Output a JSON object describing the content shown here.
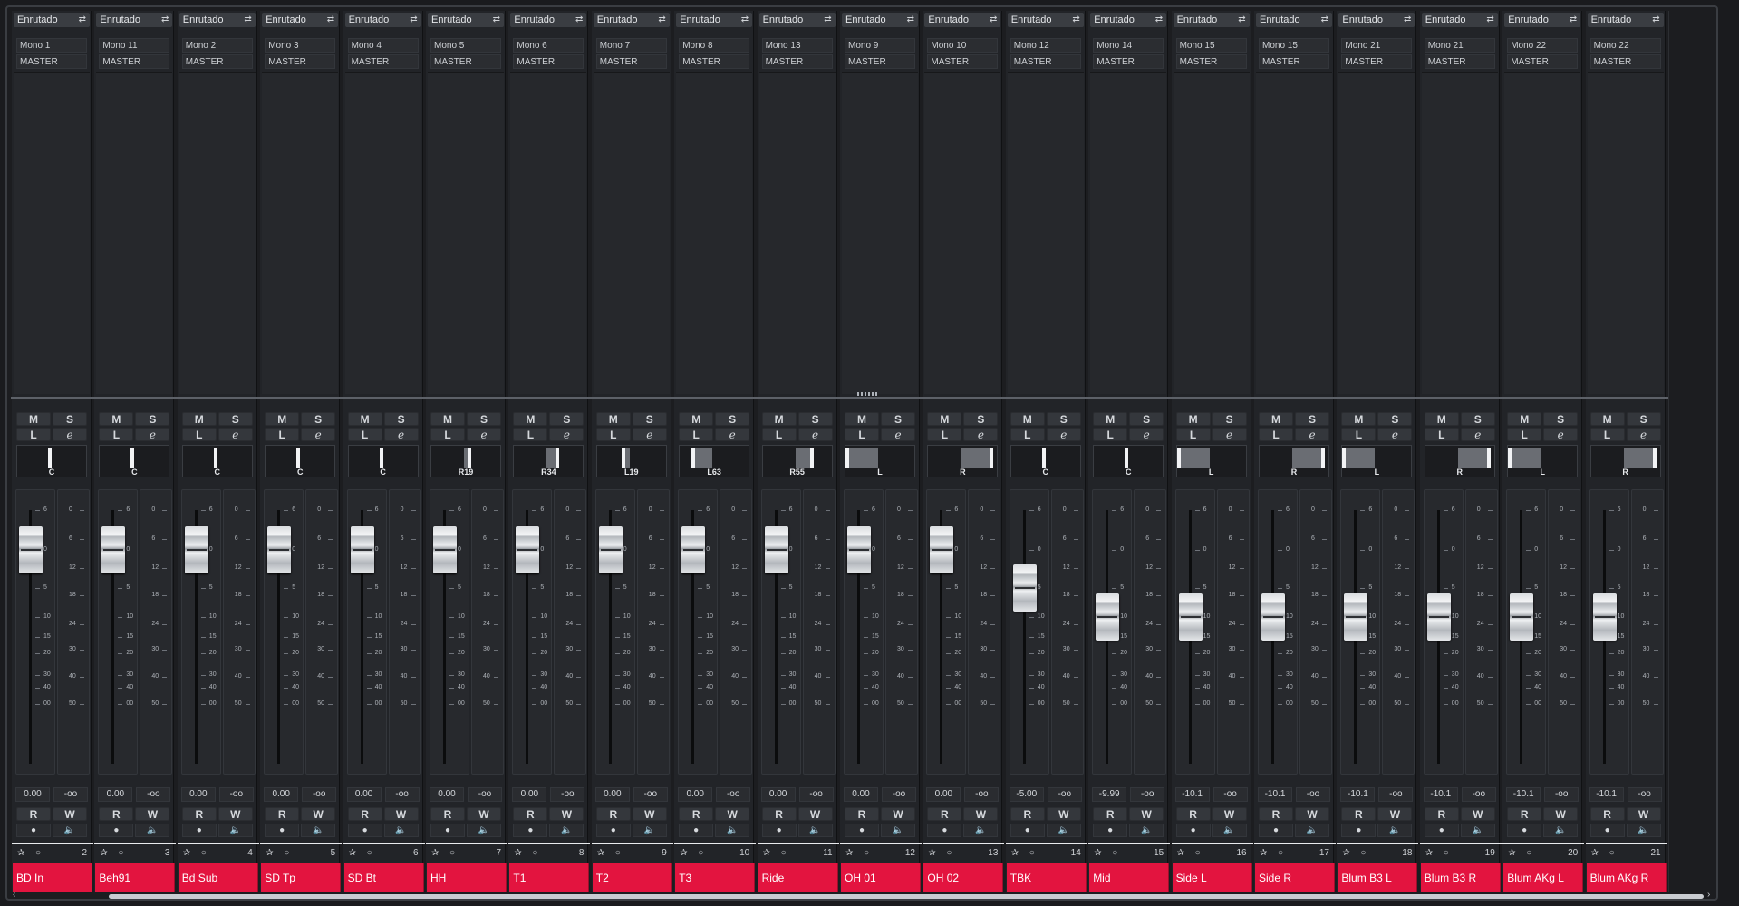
{
  "channels": [
    {
      "route_label": "Enrutado",
      "input": "Mono 1",
      "output": "MASTER",
      "pan_label": "C",
      "volume": "0.00",
      "peak": "-oo",
      "number": "2",
      "name": "BD In",
      "fader_db": 0
    },
    {
      "route_label": "Enrutado",
      "input": "Mono 11",
      "output": "MASTER",
      "pan_label": "C",
      "volume": "0.00",
      "peak": "-oo",
      "number": "3",
      "name": "Beh91",
      "fader_db": 0
    },
    {
      "route_label": "Enrutado",
      "input": "Mono 2",
      "output": "MASTER",
      "pan_label": "C",
      "volume": "0.00",
      "peak": "-oo",
      "number": "4",
      "name": "Bd Sub",
      "fader_db": 0
    },
    {
      "route_label": "Enrutado",
      "input": "Mono 3",
      "output": "MASTER",
      "pan_label": "C",
      "volume": "0.00",
      "peak": "-oo",
      "number": "5",
      "name": "SD Tp",
      "fader_db": 0
    },
    {
      "route_label": "Enrutado",
      "input": "Mono 4",
      "output": "MASTER",
      "pan_label": "C",
      "volume": "0.00",
      "peak": "-oo",
      "number": "6",
      "name": "SD Bt",
      "fader_db": 0
    },
    {
      "route_label": "Enrutado",
      "input": "Mono 5",
      "output": "MASTER",
      "pan_label": "R19",
      "volume": "0.00",
      "peak": "-oo",
      "number": "7",
      "name": "HH",
      "fader_db": 0
    },
    {
      "route_label": "Enrutado",
      "input": "Mono 6",
      "output": "MASTER",
      "pan_label": "R34",
      "volume": "0.00",
      "peak": "-oo",
      "number": "8",
      "name": "T1",
      "fader_db": 0
    },
    {
      "route_label": "Enrutado",
      "input": "Mono 7",
      "output": "MASTER",
      "pan_label": "L19",
      "volume": "0.00",
      "peak": "-oo",
      "number": "9",
      "name": "T2",
      "fader_db": 0
    },
    {
      "route_label": "Enrutado",
      "input": "Mono 8",
      "output": "MASTER",
      "pan_label": "L63",
      "volume": "0.00",
      "peak": "-oo",
      "number": "10",
      "name": "T3",
      "fader_db": 0
    },
    {
      "route_label": "Enrutado",
      "input": "Mono 13",
      "output": "MASTER",
      "pan_label": "R55",
      "volume": "0.00",
      "peak": "-oo",
      "number": "11",
      "name": "Ride",
      "fader_db": 0
    },
    {
      "route_label": "Enrutado",
      "input": "Mono 9",
      "output": "MASTER",
      "pan_label": "L",
      "volume": "0.00",
      "peak": "-oo",
      "number": "12",
      "name": "OH 01",
      "fader_db": 0
    },
    {
      "route_label": "Enrutado",
      "input": "Mono 10",
      "output": "MASTER",
      "pan_label": "R",
      "volume": "0.00",
      "peak": "-oo",
      "number": "13",
      "name": "OH 02",
      "fader_db": 0
    },
    {
      "route_label": "Enrutado",
      "input": "Mono 12",
      "output": "MASTER",
      "pan_label": "C",
      "volume": "-5.00",
      "peak": "-oo",
      "number": "14",
      "name": "TBK",
      "fader_db": -5
    },
    {
      "route_label": "Enrutado",
      "input": "Mono 14",
      "output": "MASTER",
      "pan_label": "C",
      "volume": "-9.99",
      "peak": "-oo",
      "number": "15",
      "name": "Mid",
      "fader_db": -10
    },
    {
      "route_label": "Enrutado",
      "input": "Mono 15",
      "output": "MASTER",
      "pan_label": "L",
      "volume": "-10.1",
      "peak": "-oo",
      "number": "16",
      "name": "Side L",
      "fader_db": -10
    },
    {
      "route_label": "Enrutado",
      "input": "Mono 15",
      "output": "MASTER",
      "pan_label": "R",
      "volume": "-10.1",
      "peak": "-oo",
      "number": "17",
      "name": "Side R",
      "fader_db": -10
    },
    {
      "route_label": "Enrutado",
      "input": "Mono 21",
      "output": "MASTER",
      "pan_label": "L",
      "volume": "-10.1",
      "peak": "-oo",
      "number": "18",
      "name": "Blum B3 L",
      "fader_db": -10
    },
    {
      "route_label": "Enrutado",
      "input": "Mono 21",
      "output": "MASTER",
      "pan_label": "R",
      "volume": "-10.1",
      "peak": "-oo",
      "number": "19",
      "name": "Blum B3 R",
      "fader_db": -10
    },
    {
      "route_label": "Enrutado",
      "input": "Mono 22",
      "output": "MASTER",
      "pan_label": "L",
      "volume": "-10.1",
      "peak": "-oo",
      "number": "20",
      "name": "Blum AKg L",
      "fader_db": -10
    },
    {
      "route_label": "Enrutado",
      "input": "Mono 22",
      "output": "MASTER",
      "pan_label": "R",
      "volume": "-10.1",
      "peak": "-oo",
      "number": "21",
      "name": "Blum AKg R",
      "fader_db": -10
    }
  ],
  "buttons": {
    "mute": "M",
    "solo": "S",
    "listen": "L",
    "edit": "e",
    "read": "R",
    "write": "W"
  },
  "fader_scale": [
    "6",
    "0",
    "5",
    "10",
    "15",
    "20",
    "30",
    "40",
    "00"
  ],
  "meter_scale": [
    "0",
    "6",
    "12",
    "18",
    "24",
    "30",
    "40",
    "50"
  ],
  "colors": {
    "channel_name_band": "#e3143f"
  },
  "icons": {
    "route": "route-icon",
    "monitor": "speaker-icon",
    "record": "record-dot-icon",
    "insert": "insert-icon"
  }
}
